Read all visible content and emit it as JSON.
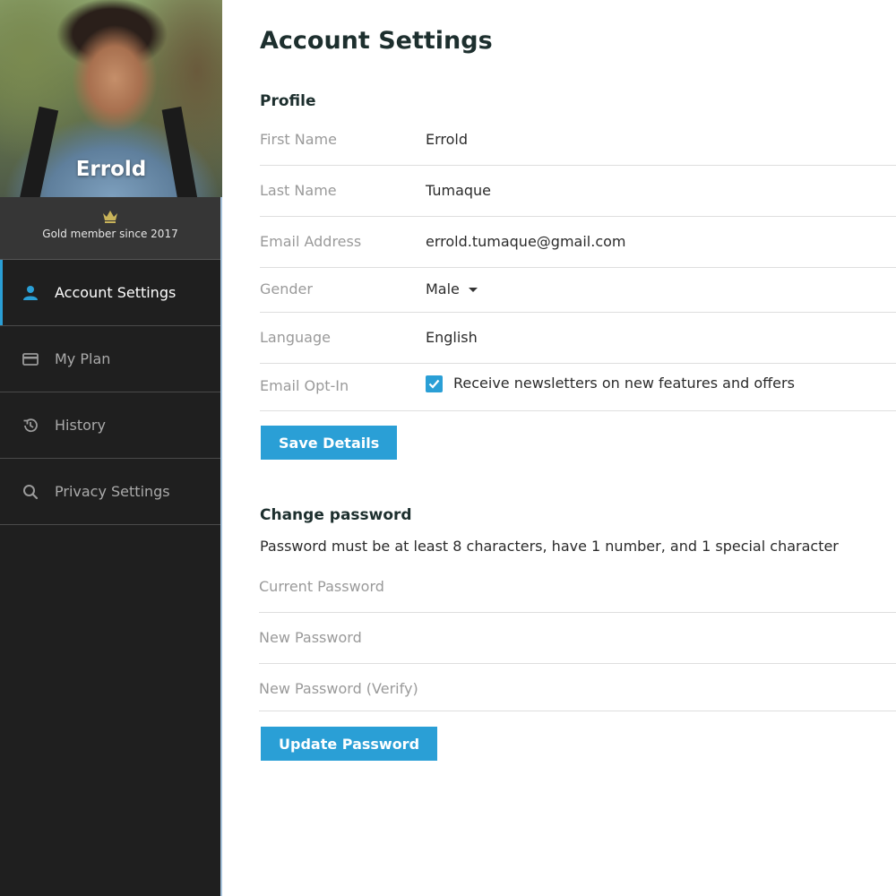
{
  "sidebar": {
    "user_name": "Errold",
    "membership": "Gold member since 2017",
    "nav": [
      {
        "label": "Account Settings",
        "icon": "person-icon",
        "active": true
      },
      {
        "label": "My Plan",
        "icon": "credit-card-icon",
        "active": false
      },
      {
        "label": "History",
        "icon": "history-icon",
        "active": false
      },
      {
        "label": "Privacy Settings",
        "icon": "search-icon",
        "active": false
      }
    ]
  },
  "page": {
    "title": "Account Settings"
  },
  "profile": {
    "section_title": "Profile",
    "fields": [
      {
        "label": "First Name",
        "value": "Errold"
      },
      {
        "label": "Last Name",
        "value": "Tumaque"
      },
      {
        "label": "Email Address",
        "value": "errold.tumaque@gmail.com"
      },
      {
        "label": "Gender",
        "value": "Male"
      },
      {
        "label": "Language",
        "value": "English"
      },
      {
        "label": "Email Opt-In",
        "value": "Receive newsletters on new features and offers",
        "checked": true
      }
    ],
    "save_label": "Save Details"
  },
  "password": {
    "section_title": "Change password",
    "hint": "Password must be at least 8 characters, have 1 number, and 1 special character",
    "current_placeholder": "Current Password",
    "new_placeholder": "New Password",
    "verify_placeholder": "New Password (Verify)",
    "update_label": "Update Password"
  },
  "colors": {
    "accent": "#2a9fd6",
    "sidebar_bg": "#1f1f1f",
    "crown": "#c9b45a"
  }
}
